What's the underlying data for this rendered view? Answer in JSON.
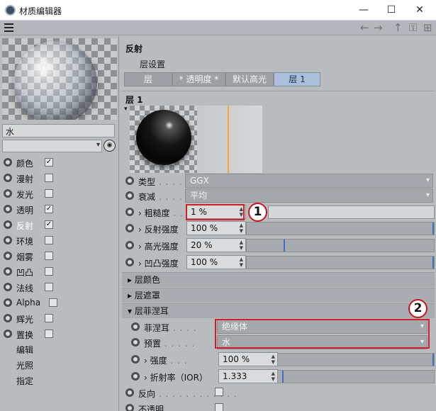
{
  "window": {
    "title": "材质编辑器",
    "minimize": "—",
    "maximize": "☐",
    "close": "✕"
  },
  "toolbar": {
    "back": "←",
    "forward": "→",
    "up": "↑",
    "lock": "⚿",
    "new_window": "⊞"
  },
  "left": {
    "material_name": "水",
    "channels": [
      {
        "label": "颜色",
        "checked": true
      },
      {
        "label": "漫射",
        "checked": false
      },
      {
        "label": "发光",
        "checked": false
      },
      {
        "label": "透明",
        "checked": true
      },
      {
        "label": "反射",
        "checked": true,
        "active": true
      },
      {
        "label": "环境",
        "checked": false
      },
      {
        "label": "烟雾",
        "checked": false
      },
      {
        "label": "凹凸",
        "checked": false
      },
      {
        "label": "法线",
        "checked": false
      },
      {
        "label": "Alpha",
        "checked": false
      },
      {
        "label": "辉光",
        "checked": false
      },
      {
        "label": "置换",
        "checked": false
      }
    ],
    "extra": [
      "编辑",
      "光照",
      "指定"
    ]
  },
  "right": {
    "section_title": "反射",
    "layer_settings": "层设置",
    "tabs": [
      {
        "label": "层",
        "selected": false
      },
      {
        "label": "* 透明度 *",
        "selected": false
      },
      {
        "label": "默认高光",
        "selected": false
      },
      {
        "label": "层 1",
        "selected": true
      }
    ],
    "layer_title": "层 1",
    "type": {
      "label": "类型",
      "value": "GGX"
    },
    "falloff": {
      "label": "衰减",
      "value": "平均"
    },
    "roughness": {
      "label": "粗糙度",
      "value": "1 %",
      "level": 0.01
    },
    "refl_strength": {
      "label": "反射强度",
      "value": "100 %",
      "level": 1.0
    },
    "spec_strength": {
      "label": "高光强度",
      "value": "20 %",
      "level": 0.2
    },
    "bump_strength": {
      "label": "凹凸强度",
      "value": "100 %",
      "level": 1.0
    },
    "groups": {
      "layer_color": "层颜色",
      "layer_mask": "层遮罩",
      "layer_fresnel": "层菲涅耳"
    },
    "fresnel": {
      "label": "菲涅耳",
      "value": "绝缘体"
    },
    "preset": {
      "label": "预置",
      "value": "水"
    },
    "f_strength": {
      "label": "强度",
      "value": "100 %",
      "level": 1.0
    },
    "ior": {
      "label": "折射率（IOR）",
      "value": "1.333"
    },
    "invert": {
      "label": "反向"
    },
    "opaque": {
      "label": "不透明"
    }
  },
  "callouts": [
    "1",
    "2"
  ],
  "colors": {
    "highlight_red": "#d2202a",
    "tab_selected": "#a9bfdc",
    "gradient_line": "#f3a63c"
  }
}
